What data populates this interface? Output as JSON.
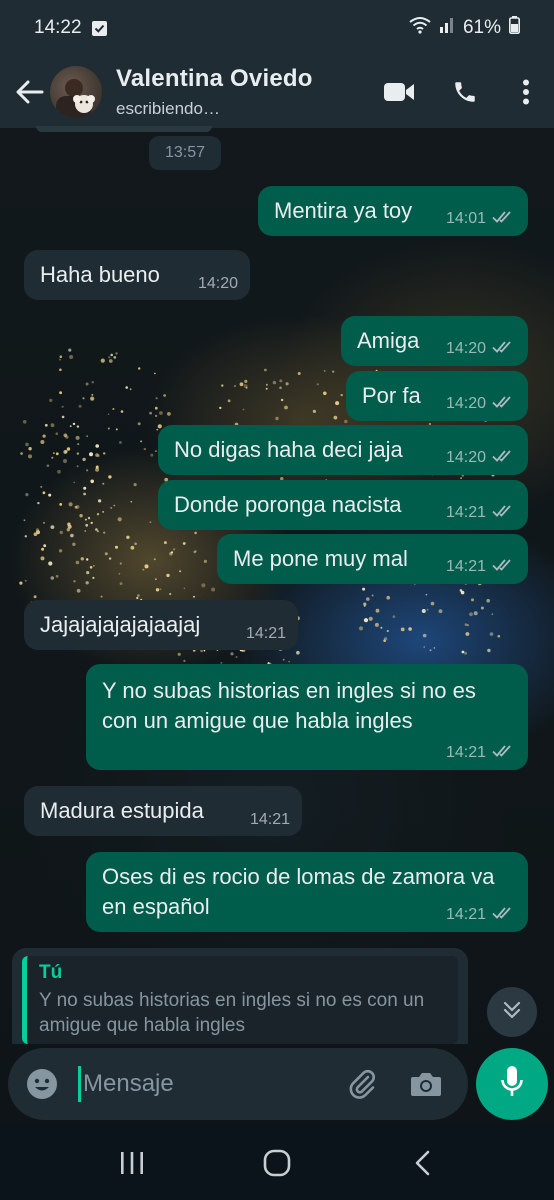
{
  "status_bar": {
    "time": "14:22",
    "battery": "61%",
    "icons": [
      "notification-check-icon",
      "wifi-icon",
      "signal-icon",
      "battery-icon"
    ]
  },
  "header": {
    "contact_name": "Valentina Oviedo",
    "contact_status": "escribiendo…",
    "icons": [
      "back-arrow-icon",
      "video-call-icon",
      "phone-call-icon",
      "more-options-icon"
    ]
  },
  "chat": {
    "date_chip": "13:57",
    "messages": [
      {
        "direction": "out",
        "text": "Mentira ya toy",
        "time": "14:01",
        "status": "read"
      },
      {
        "direction": "in",
        "text": "Haha bueno",
        "time": "14:20"
      },
      {
        "direction": "out",
        "text": "Amiga",
        "time": "14:20",
        "status": "read"
      },
      {
        "direction": "out",
        "text": "Por fa",
        "time": "14:20",
        "status": "read"
      },
      {
        "direction": "out",
        "text": "No digas haha deci jaja",
        "time": "14:20",
        "status": "read"
      },
      {
        "direction": "out",
        "text": "Donde poronga nacista",
        "time": "14:21",
        "status": "read"
      },
      {
        "direction": "out",
        "text": "Me pone muy mal",
        "time": "14:21",
        "status": "read"
      },
      {
        "direction": "in",
        "text": "Jajajajajajajaajaj",
        "time": "14:21"
      },
      {
        "direction": "out",
        "text": "Y no subas historias en ingles si no es con un amigue que habla ingles",
        "time": "14:21",
        "status": "read"
      },
      {
        "direction": "in",
        "text": "Madura estupida",
        "time": "14:21"
      },
      {
        "direction": "out",
        "text": "Oses di es rocio de lomas de zamora va en español",
        "time": "14:21",
        "status": "read"
      }
    ]
  },
  "reply_preview": {
    "author": "Tú",
    "text": "Y no subas historias en ingles si no es con un amigue que habla ingles"
  },
  "composer": {
    "placeholder": "Mensaje",
    "value": "",
    "icons": [
      "emoji-icon",
      "attach-icon",
      "camera-icon",
      "mic-icon"
    ]
  },
  "nav_bar": {
    "icons": [
      "recent-apps-icon",
      "home-icon",
      "back-nav-icon"
    ]
  },
  "colors": {
    "outgoing_bubble": "#005c4b",
    "incoming_bubble": "#1f2c34",
    "accent": "#00a884",
    "read_ticks": "#8696a0"
  }
}
